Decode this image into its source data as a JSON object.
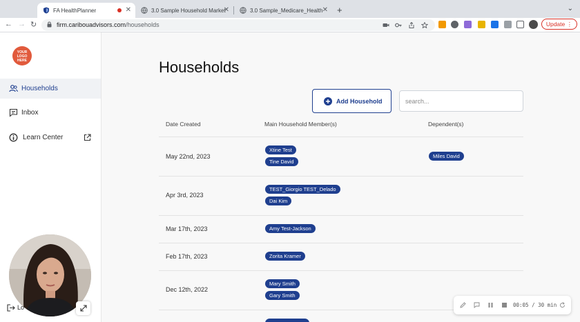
{
  "browser": {
    "tabs": [
      {
        "title": "FA HealthPlanner",
        "active": true
      },
      {
        "title": "3.0 Sample Household Market",
        "active": false
      },
      {
        "title": "3.0 Sample_Medicare_Health",
        "active": false
      }
    ],
    "url_domain": "firm.caribouadvisors.com",
    "url_path": "/households",
    "update_label": "Update"
  },
  "sidebar": {
    "logo_text": "YOUR LOGO HERE",
    "items": [
      {
        "label": "Households",
        "icon": "people-icon",
        "active": true
      },
      {
        "label": "Inbox",
        "icon": "chat-icon",
        "active": false
      },
      {
        "label": "Learn Center",
        "icon": "info-icon",
        "active": false
      }
    ],
    "logout_label": "Lo"
  },
  "main": {
    "title": "Households",
    "add_button_label": "Add Household",
    "search_placeholder": "search...",
    "columns": [
      "Date Created",
      "Main Household Member(s)",
      "Dependent(s)"
    ],
    "rows": [
      {
        "date": "May 22nd, 2023",
        "members": [
          "Xtine Test",
          "Tine David"
        ],
        "dependents": [
          "Miles David"
        ]
      },
      {
        "date": "Apr 3rd, 2023",
        "members": [
          "TEST_Giorgio TEST_Delado",
          "Dai Kim"
        ],
        "dependents": []
      },
      {
        "date": "Mar 17th, 2023",
        "members": [
          "Amy Test-Jackson"
        ],
        "dependents": []
      },
      {
        "date": "Feb 17th, 2023",
        "members": [
          "Zorita Kramer"
        ],
        "dependents": []
      },
      {
        "date": "Dec 12th, 2022",
        "members": [
          "Mary Smith",
          "Gary Smith"
        ],
        "dependents": []
      }
    ]
  },
  "recorder": {
    "time": "00:05 / 30 min"
  },
  "colors": {
    "brand": "#1f3f8f",
    "logo": "#e15a3c",
    "update": "#d93025"
  }
}
